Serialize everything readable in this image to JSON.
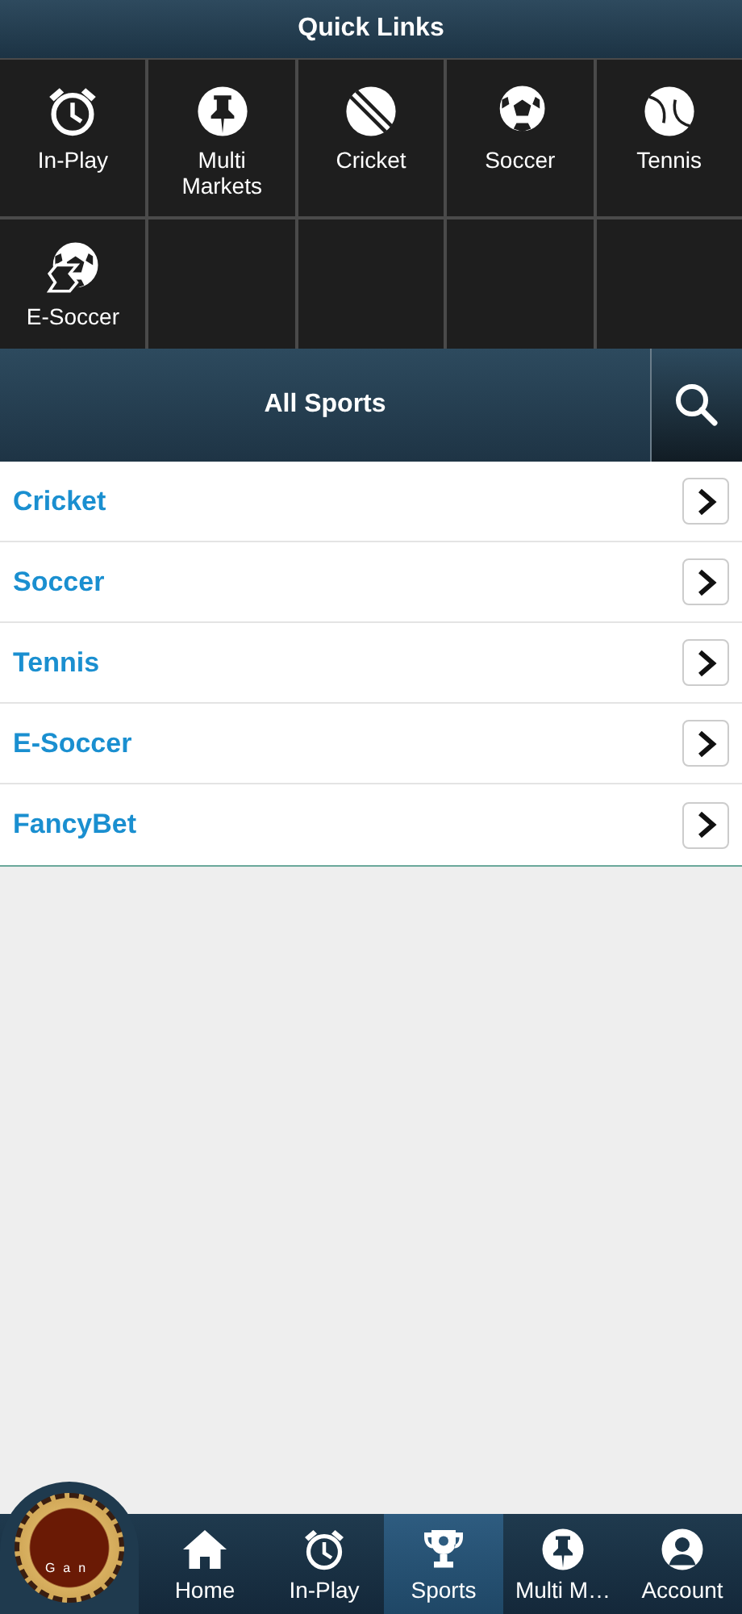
{
  "quick_links": {
    "title": "Quick Links",
    "items": [
      {
        "label": "In-Play",
        "kind": "clock"
      },
      {
        "label": "Multi\nMarkets",
        "kind": "pin"
      },
      {
        "label": "Cricket",
        "kind": "cricket"
      },
      {
        "label": "Soccer",
        "kind": "soccer"
      },
      {
        "label": "Tennis",
        "kind": "tennis"
      },
      {
        "label": "E-Soccer",
        "kind": "esoccer"
      }
    ]
  },
  "all_sports": {
    "title": "All Sports",
    "items": [
      {
        "label": "Cricket"
      },
      {
        "label": "Soccer"
      },
      {
        "label": "Tennis"
      },
      {
        "label": "E-Soccer"
      },
      {
        "label": "FancyBet"
      }
    ]
  },
  "bottom_nav": {
    "chip_label": "Gan",
    "items": [
      {
        "label": "Home",
        "kind": "home",
        "selected": false
      },
      {
        "label": "In-Play",
        "kind": "clock",
        "selected": false
      },
      {
        "label": "Sports",
        "kind": "trophy",
        "selected": true
      },
      {
        "label": "Multi M…",
        "kind": "pin",
        "selected": false
      },
      {
        "label": "Account",
        "kind": "user",
        "selected": false
      }
    ]
  }
}
